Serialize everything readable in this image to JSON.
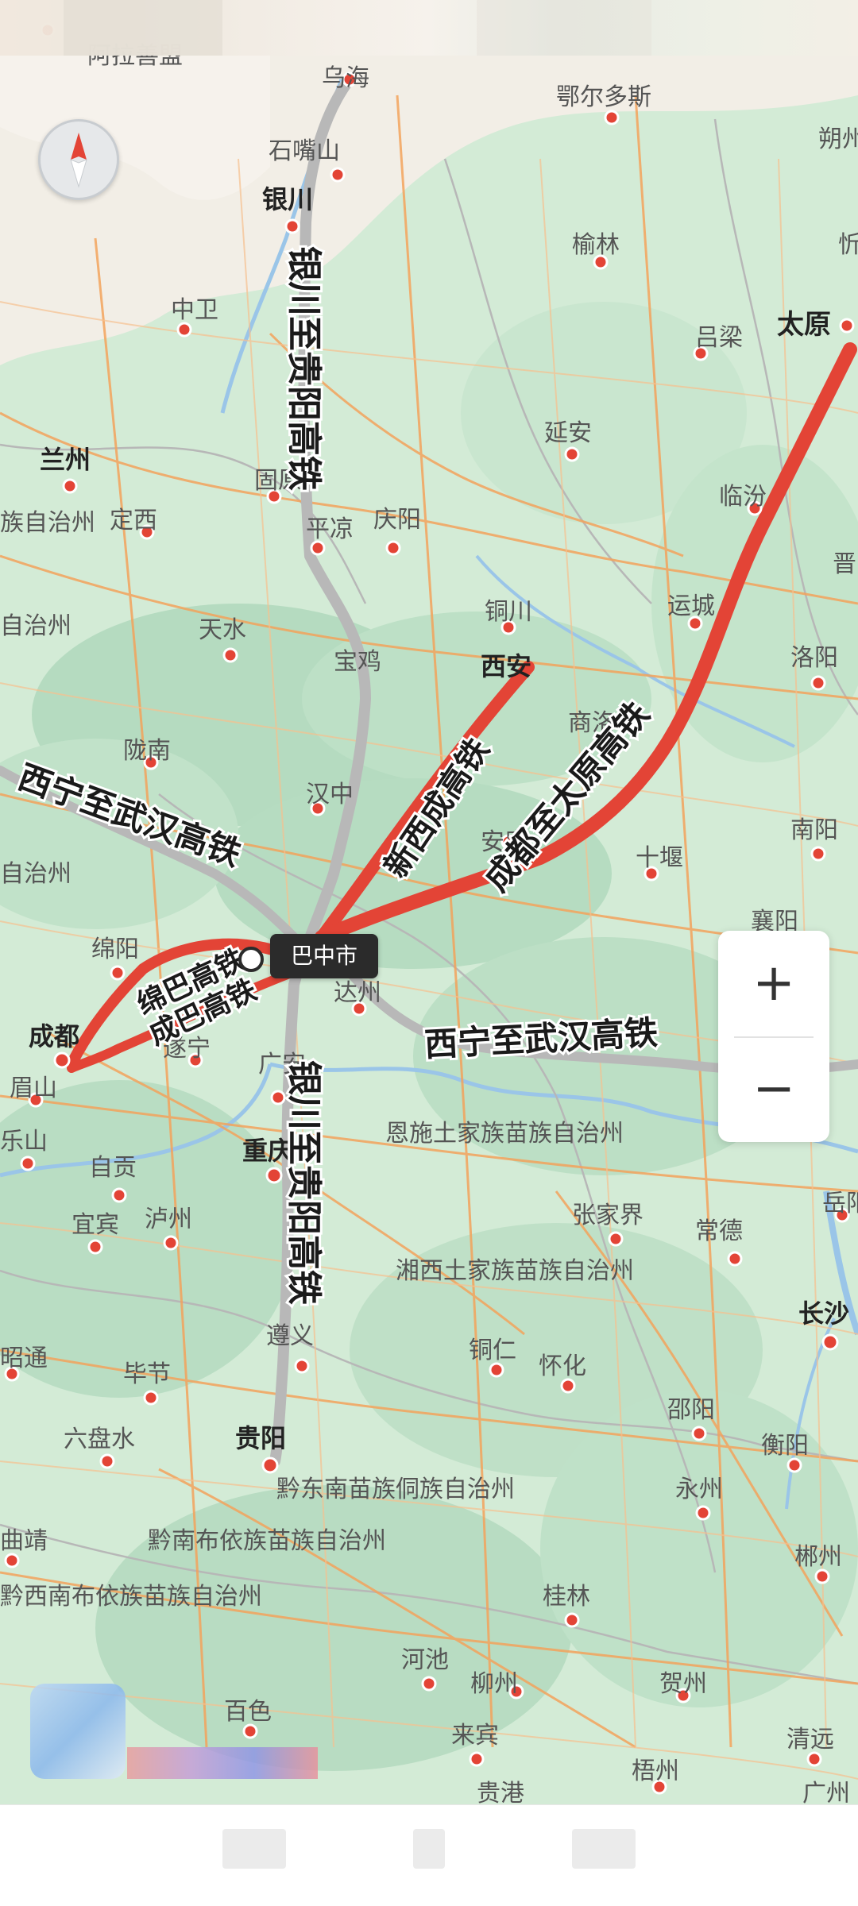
{
  "map": {
    "selected_city": "巴中市",
    "colors": {
      "land": "#cfe9d3",
      "terrain": "#b8dcc1",
      "desert": "#f2ede4",
      "river": "#9ac5e8",
      "road": "#f3a35c",
      "route_red": "#e34436",
      "route_grey": "#b8b8b8"
    },
    "rail_lines": [
      {
        "name": "银川至贵阳高铁",
        "color": "grey"
      },
      {
        "name": "西宁至武汉高铁",
        "color": "grey"
      },
      {
        "name": "新西成高铁",
        "color": "red"
      },
      {
        "name": "成都至太原高铁",
        "color": "red"
      },
      {
        "name": "绵巴高铁",
        "color": "red"
      },
      {
        "name": "成巴高铁",
        "color": "red"
      }
    ],
    "line_labels": [
      {
        "text": "银川至贵阳高铁"
      },
      {
        "text": "银川至贵阳高铁"
      },
      {
        "text": "西宁至武汉高铁"
      },
      {
        "text": "西宁至武汉高铁"
      },
      {
        "text": "新西成高铁"
      },
      {
        "text": "成都至太原高铁"
      },
      {
        "text": "绵巴高铁"
      },
      {
        "text": "成巴高铁"
      }
    ],
    "place_labels": [
      {
        "text": "阿拉善盟",
        "bold": false
      },
      {
        "text": "乌海",
        "bold": false
      },
      {
        "text": "鄂尔多斯",
        "bold": false
      },
      {
        "text": "朔州",
        "bold": false
      },
      {
        "text": "石嘴山",
        "bold": false
      },
      {
        "text": "银川",
        "bold": true
      },
      {
        "text": "榆林",
        "bold": false
      },
      {
        "text": "忻",
        "bold": false
      },
      {
        "text": "中卫",
        "bold": false
      },
      {
        "text": "吕梁",
        "bold": false
      },
      {
        "text": "太原",
        "bold": true
      },
      {
        "text": "兰州",
        "bold": true
      },
      {
        "text": "延安",
        "bold": false
      },
      {
        "text": "固原",
        "bold": false
      },
      {
        "text": "临汾",
        "bold": false
      },
      {
        "text": "族自治州",
        "bold": false
      },
      {
        "text": "定西",
        "bold": false
      },
      {
        "text": "平凉",
        "bold": false
      },
      {
        "text": "庆阳",
        "bold": false
      },
      {
        "text": "晋",
        "bold": false
      },
      {
        "text": "铜川",
        "bold": false
      },
      {
        "text": "运城",
        "bold": false
      },
      {
        "text": "自治州",
        "bold": false
      },
      {
        "text": "天水",
        "bold": false
      },
      {
        "text": "西安",
        "bold": true
      },
      {
        "text": "洛阳",
        "bold": false
      },
      {
        "text": "宝鸡",
        "bold": false
      },
      {
        "text": "商洛",
        "bold": false
      },
      {
        "text": "陇南",
        "bold": false
      },
      {
        "text": "汉中",
        "bold": false
      },
      {
        "text": "南阳",
        "bold": false
      },
      {
        "text": "安康",
        "bold": false
      },
      {
        "text": "自治州",
        "bold": false
      },
      {
        "text": "十堰",
        "bold": false
      },
      {
        "text": "绵阳",
        "bold": false
      },
      {
        "text": "襄阳",
        "bold": false
      },
      {
        "text": "达州",
        "bold": false
      },
      {
        "text": "成都",
        "bold": true
      },
      {
        "text": "遂宁",
        "bold": false
      },
      {
        "text": "眉山",
        "bold": false
      },
      {
        "text": "广安",
        "bold": false
      },
      {
        "text": "恩施土家族苗族自治州",
        "bold": false
      },
      {
        "text": "乐山",
        "bold": false
      },
      {
        "text": "重庆",
        "bold": true
      },
      {
        "text": "自贡",
        "bold": false
      },
      {
        "text": "岳阳",
        "bold": false
      },
      {
        "text": "宜宾",
        "bold": false
      },
      {
        "text": "泸州",
        "bold": false
      },
      {
        "text": "张家界",
        "bold": false
      },
      {
        "text": "常德",
        "bold": false
      },
      {
        "text": "湘西土家族苗族自治州",
        "bold": false
      },
      {
        "text": "长沙",
        "bold": true
      },
      {
        "text": "昭通",
        "bold": false
      },
      {
        "text": "遵义",
        "bold": false
      },
      {
        "text": "铜仁",
        "bold": false
      },
      {
        "text": "怀化",
        "bold": false
      },
      {
        "text": "毕节",
        "bold": false
      },
      {
        "text": "邵阳",
        "bold": false
      },
      {
        "text": "六盘水",
        "bold": false
      },
      {
        "text": "贵阳",
        "bold": true
      },
      {
        "text": "衡阳",
        "bold": false
      },
      {
        "text": "黔东南苗族侗族自治州",
        "bold": false
      },
      {
        "text": "永州",
        "bold": false
      },
      {
        "text": "曲靖",
        "bold": false
      },
      {
        "text": "黔南布依族苗族自治州",
        "bold": false
      },
      {
        "text": "郴州",
        "bold": false
      },
      {
        "text": "黔西南布依族苗族自治州",
        "bold": false
      },
      {
        "text": "桂林",
        "bold": false
      },
      {
        "text": "河池",
        "bold": false
      },
      {
        "text": "柳州",
        "bold": false
      },
      {
        "text": "贺州",
        "bold": false
      },
      {
        "text": "百色",
        "bold": false
      },
      {
        "text": "来宾",
        "bold": false
      },
      {
        "text": "清远",
        "bold": false
      },
      {
        "text": "梧州",
        "bold": false
      },
      {
        "text": "贵港",
        "bold": false
      },
      {
        "text": "广州",
        "bold": false
      }
    ]
  },
  "controls": {
    "zoom_in_label": "+",
    "zoom_out_label": "−",
    "compass_icon": "compass-icon"
  }
}
